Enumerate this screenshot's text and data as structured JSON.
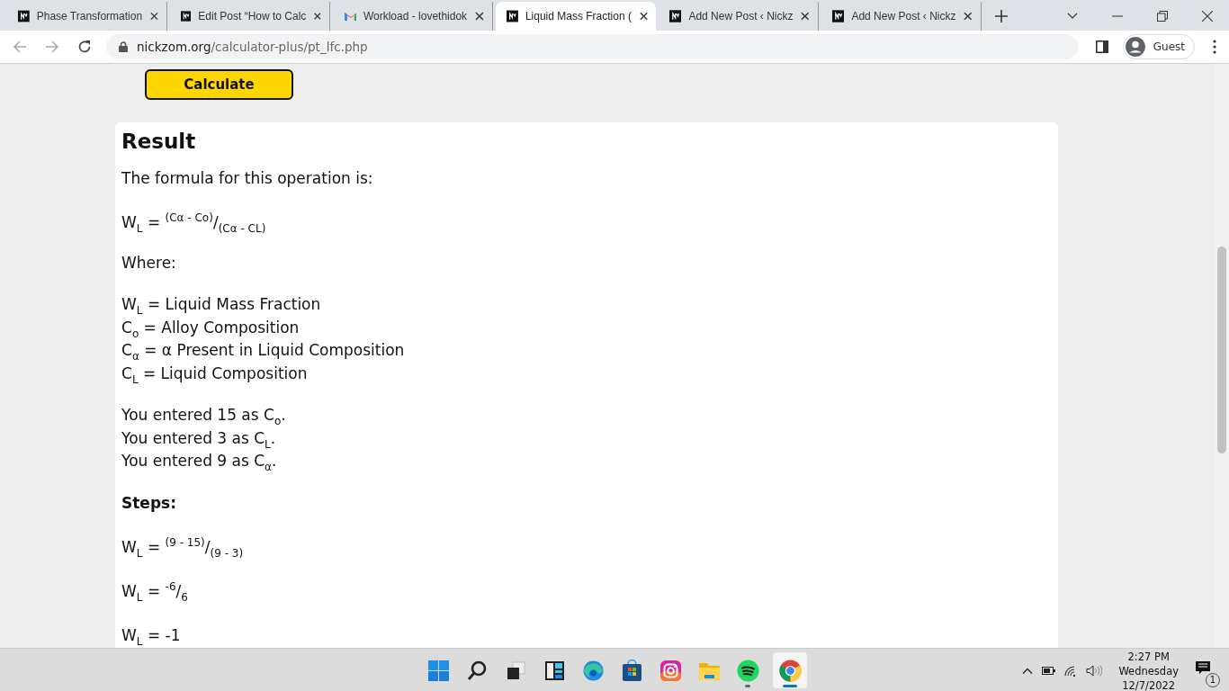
{
  "browser": {
    "tabs": [
      {
        "title": "Phase Transformation",
        "kind": "site",
        "selected": false
      },
      {
        "title": "Edit Post “How to Calc",
        "kind": "site",
        "selected": false
      },
      {
        "title": "Workload - lovethidok",
        "kind": "mail",
        "selected": false
      },
      {
        "title": "Liquid Mass Fraction (",
        "kind": "site",
        "selected": true
      },
      {
        "title": "Add New Post ‹ Nickz",
        "kind": "site",
        "selected": false
      },
      {
        "title": "Add New Post ‹ Nickz",
        "kind": "site",
        "selected": false
      }
    ],
    "url_host": "nickzom.org",
    "url_path": "/calculator-plus/pt_lfc.php",
    "profile": "Guest"
  },
  "page": {
    "calculate_button": "Calculate",
    "result": {
      "heading": "Result",
      "blocks": [
        {
          "kind": "text",
          "text": "The formula for this operation is:",
          "bold": false
        },
        {
          "kind": "formula",
          "text": "W$_{L}$ = $^{(Cα - Co)}$/$_{(Cα - CL)}$"
        },
        {
          "kind": "text",
          "text": "Where:",
          "bold": false
        },
        {
          "kind": "lines",
          "lines": [
            "W$_{L}$ = Liquid Mass Fraction",
            "C$_{o}$ = Alloy Composition",
            "C$_{α}$ = α Present in Liquid Composition",
            "C$_{L}$ = Liquid Composition"
          ]
        },
        {
          "kind": "lines",
          "lines": [
            "You entered 15 as C$_{o}$.",
            "You entered 3 as C$_{L}$.",
            "You entered 9 as C$_{α}$."
          ]
        },
        {
          "kind": "text",
          "text": "Steps:",
          "bold": true
        },
        {
          "kind": "formula",
          "text": "W$_{L}$ = $^{(9 - 15)}$/$_{(9 - 3)}$"
        },
        {
          "kind": "formula",
          "text": "W$_{L}$ = $^{-6}$/$_{6}$"
        },
        {
          "kind": "formula",
          "text": "W$_{L}$ = -1"
        }
      ]
    }
  },
  "taskbar": {
    "apps": [
      {
        "kind": "start",
        "running": false,
        "active": false
      },
      {
        "kind": "search",
        "running": false,
        "active": false
      },
      {
        "kind": "taskview",
        "running": false,
        "active": false
      },
      {
        "kind": "widgets",
        "running": false,
        "active": false
      },
      {
        "kind": "edge",
        "running": false,
        "active": false
      },
      {
        "kind": "store",
        "running": false,
        "active": false
      },
      {
        "kind": "instagram",
        "running": false,
        "active": false
      },
      {
        "kind": "folder",
        "running": false,
        "active": false
      },
      {
        "kind": "spotify",
        "running": true,
        "active": false
      },
      {
        "kind": "chrome",
        "running": true,
        "active": true
      }
    ],
    "time": "2:27 PM",
    "day": "Wednesday",
    "date": "12/7/2022",
    "notifications": "1"
  }
}
